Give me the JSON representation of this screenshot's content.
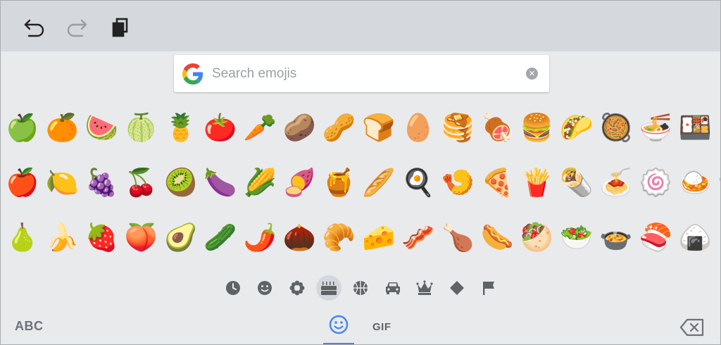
{
  "toolbar": {
    "undo_icon": "undo-icon",
    "redo_icon": "redo-icon",
    "clipboard_icon": "clipboard-icon"
  },
  "search": {
    "placeholder": "Search emojis",
    "logo": "google-g-logo",
    "clear_icon": "clear-icon"
  },
  "emoji_rows": [
    [
      "🍏",
      "🍊",
      "🍉",
      "🍈",
      "🍍",
      "🍅",
      "🥕",
      "🥔",
      "🥜",
      "🍞",
      "🥚",
      "🥞",
      "🍖",
      "🍔",
      "🌮",
      "🥘",
      "🍜",
      "🍱",
      "🥛"
    ],
    [
      "🍎",
      "🍋",
      "🍇",
      "🍒",
      "🥝",
      "🍆",
      "🌽",
      "🍠",
      "🍯",
      "🥖",
      "🍳",
      "🍤",
      "🍕",
      "🍟",
      "🌯",
      "🍝",
      "🍥",
      "🍛",
      "🍚"
    ],
    [
      "🍐",
      "🍌",
      "🍓",
      "🍑",
      "🥑",
      "🥒",
      "🌶️",
      "🌰",
      "🥐",
      "🧀",
      "🥓",
      "🍗",
      "🌭",
      "🥙",
      "🥗",
      "🍲",
      "🍣",
      "🍙",
      "🥄"
    ]
  ],
  "categories": [
    {
      "name": "recent",
      "icon": "clock-icon",
      "active": false
    },
    {
      "name": "smileys",
      "icon": "smiley-icon",
      "active": false
    },
    {
      "name": "nature",
      "icon": "flower-icon",
      "active": false
    },
    {
      "name": "food",
      "icon": "cake-icon",
      "active": true
    },
    {
      "name": "activity",
      "icon": "basketball-icon",
      "active": false
    },
    {
      "name": "travel",
      "icon": "car-icon",
      "active": false
    },
    {
      "name": "objects",
      "icon": "crown-icon",
      "active": false
    },
    {
      "name": "symbols",
      "icon": "diamond-icon",
      "active": false
    },
    {
      "name": "flags",
      "icon": "flag-icon",
      "active": false
    }
  ],
  "bottom": {
    "abc_label": "ABC",
    "gif_label": "GIF",
    "emoji_tab_icon": "smiley-icon",
    "backspace_icon": "backspace-icon",
    "accent_color": "#4285f4"
  }
}
